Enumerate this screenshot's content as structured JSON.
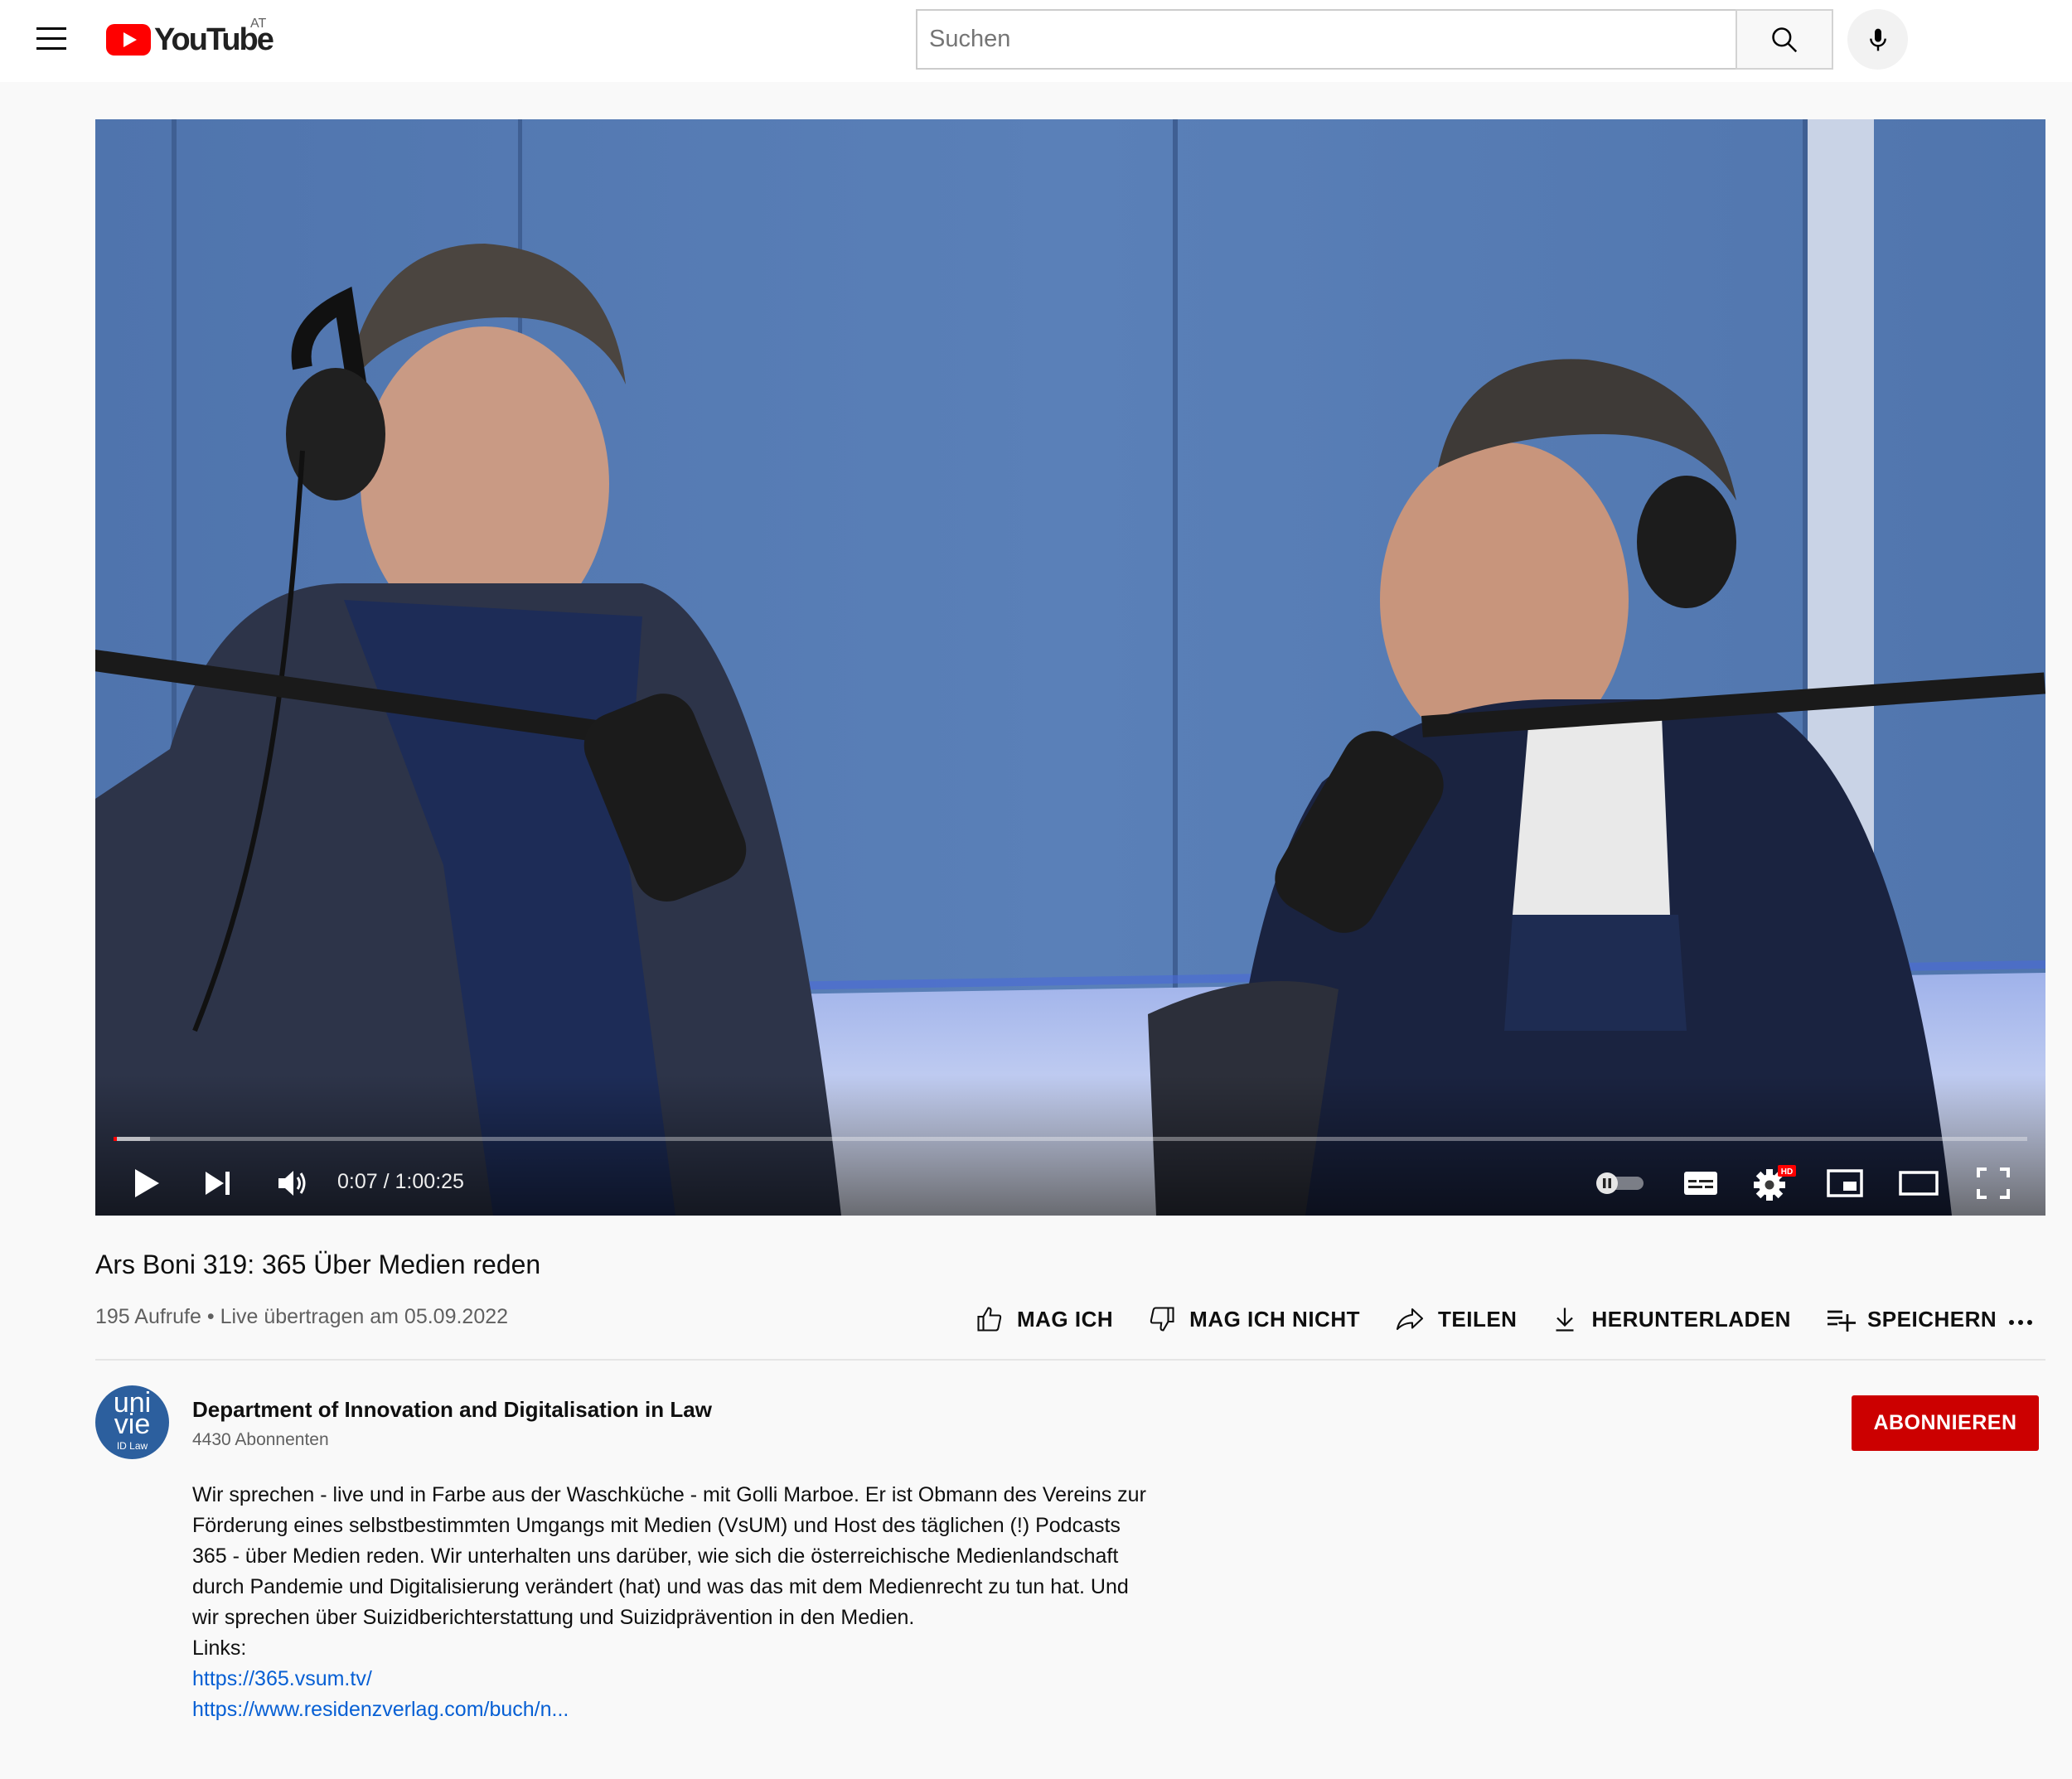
{
  "masthead": {
    "logo_text": "YouTube",
    "country_code": "AT",
    "search_placeholder": "Suchen"
  },
  "player": {
    "time_current": "0:07",
    "time_separator": "/",
    "time_total": "1:00:25",
    "progress_fraction": 0.0019,
    "buffered_fraction": 0.019,
    "settings_badge": "HD"
  },
  "video": {
    "title": "Ars Boni 319: 365 Über Medien reden",
    "views": "195 Aufrufe",
    "dot": "•",
    "streamed": "Live übertragen am 05.09.2022"
  },
  "actions": {
    "like": "MAG ICH",
    "dislike": "MAG ICH NICHT",
    "share": "TEILEN",
    "download": "HERUNTERLADEN",
    "save": "SPEICHERN"
  },
  "channel": {
    "avatar_line1": "uni",
    "avatar_line2": "vie",
    "avatar_line3": "ID Law",
    "name": "Department of Innovation and Digitalisation in Law",
    "subscribers": "4430 Abonnenten",
    "subscribe_label": "ABONNIEREN"
  },
  "description": {
    "text": "Wir sprechen - live und in Farbe aus der Waschküche - mit Golli Marboe. Er ist Obmann des Vereins zur Förderung eines selbstbestimmten Umgangs mit Medien (VsUM) und Host des täglichen (!) Podcasts 365 - über Medien reden. Wir unterhalten uns darüber, wie sich die österreichische Medienlandschaft durch Pandemie und Digitalisierung verändert (hat) und was das mit dem Medienrecht zu tun hat. Und wir sprechen über Suizidberichterstattung und Suizidprävention in den Medien.",
    "links_label": "Links:",
    "link1": "https://365.vsum.tv/",
    "link2": "https://www.residenzverlag.com/buch/n..."
  },
  "colors": {
    "accent_red": "#cc0000",
    "link_blue": "#065fd4",
    "text_secondary": "#606060"
  }
}
